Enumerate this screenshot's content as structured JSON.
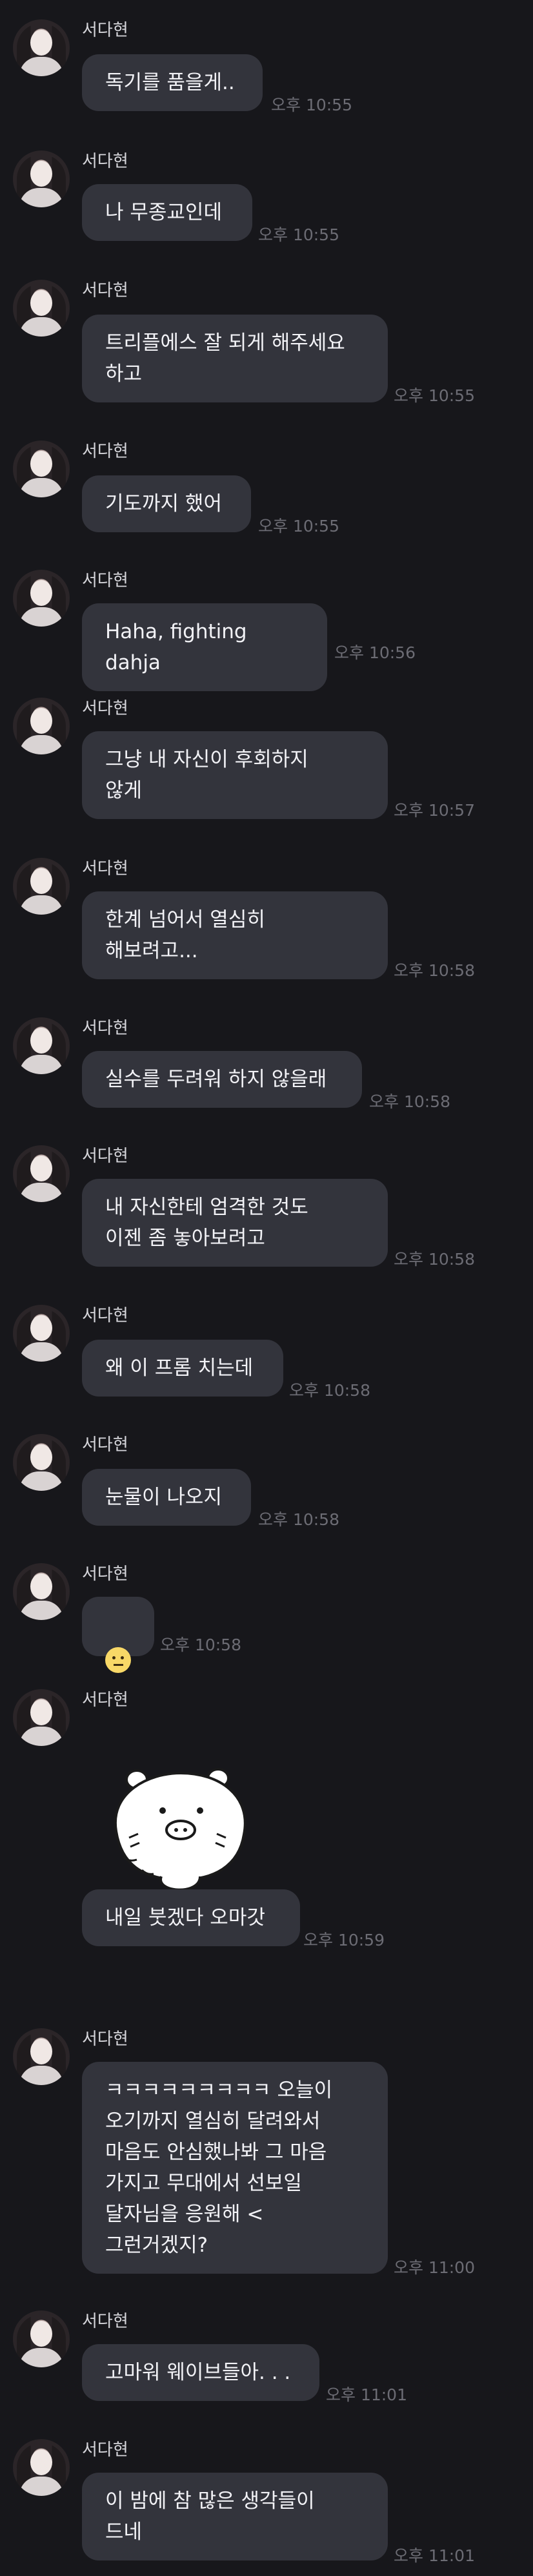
{
  "messages": [
    {
      "sender": "서다현",
      "text": "독기를 품을게..",
      "time": "오후 10:55"
    },
    {
      "sender": "서다현",
      "text": "나 무종교인데",
      "time": "오후 10:55"
    },
    {
      "sender": "서다현",
      "text": "트리플에스 잘 되게 해주세요\n하고",
      "time": "오후 10:55"
    },
    {
      "sender": "서다현",
      "text": "기도까지 했어",
      "time": "오후 10:55"
    },
    {
      "sender": "서다현",
      "text": "Haha, fighting dahja",
      "time": "오후 10:56"
    },
    {
      "sender": "서다현",
      "text": "그냥 내 자신이 후회하지\n않게",
      "time": "오후 10:57"
    },
    {
      "sender": "서다현",
      "text": "한계 넘어서 열심히\n해보려고...",
      "time": "오후 10:58"
    },
    {
      "sender": "서다현",
      "text": "실수를 두려워 하지 않을래",
      "time": "오후 10:58"
    },
    {
      "sender": "서다현",
      "text": "내 자신한테 엄격한 것도\n이젠 좀 놓아보려고",
      "time": "오후 10:58"
    },
    {
      "sender": "서다현",
      "text": "왜 이 프롬 치는데",
      "time": "오후 10:58"
    },
    {
      "sender": "서다현",
      "text": "눈물이 나오지",
      "time": "오후 10:58"
    },
    {
      "sender": "서다현",
      "emoji": "neutral-face-emoji",
      "time": "오후 10:58"
    },
    {
      "sender": "서다현",
      "sticker": "bear-sticker"
    },
    {
      "text": "내일 붓겠다 오마갓",
      "time": "오후 10:59"
    },
    {
      "sender": "서다현",
      "text": "ㅋㅋㅋㅋㅋㅋㅋㅋㅋ 오늘이\n오기까지 열심히 달려와서\n마음도 안심했나봐 그 마음\n가지고 무대에서 선보일\n달자님을 응원해 <\n그런거겠지?",
      "time": "오후 11:00"
    },
    {
      "sender": "서다현",
      "text": "고마워 웨이브들아. . .",
      "time": "오후 11:01"
    },
    {
      "sender": "서다현",
      "text": "이 밤에 참 많은 생각들이\n드네",
      "time": "오후 11:01"
    }
  ]
}
